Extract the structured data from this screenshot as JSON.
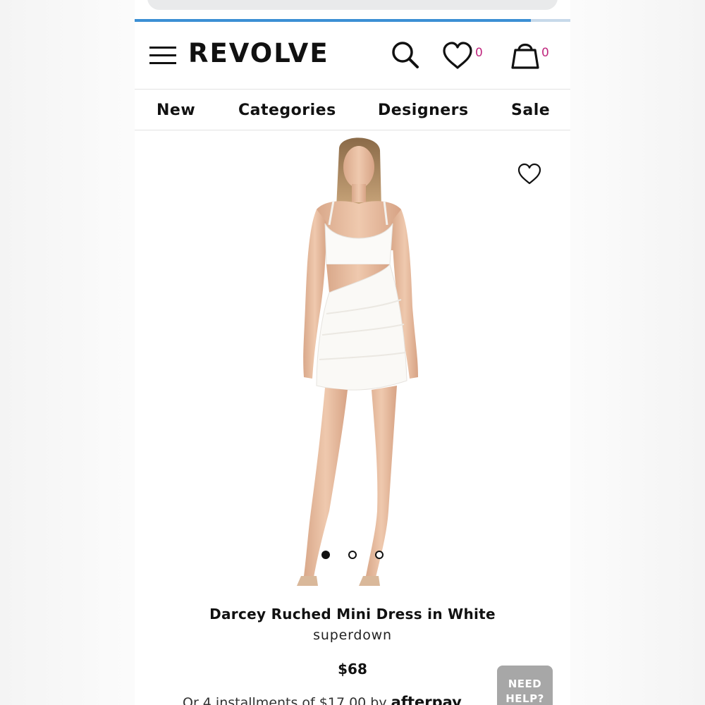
{
  "browser": {
    "page_load_progress": 0.91
  },
  "header": {
    "logo_text": "REVOLVE",
    "wishlist_count": "0",
    "bag_count": "0"
  },
  "nav": {
    "items": [
      {
        "label": "New"
      },
      {
        "label": "Categories"
      },
      {
        "label": "Designers"
      },
      {
        "label": "Sale"
      }
    ]
  },
  "product": {
    "image_description_icon": "model-photo",
    "carousel": {
      "total_dots": 3,
      "active_index": 0
    },
    "title": "Darcey Ruched Mini Dress in White",
    "brand": "superdown",
    "price": "$68",
    "installments_text": "Or 4 installments of $17.00 by",
    "installments_provider": "afterpay"
  },
  "help_button": {
    "line1": "NEED",
    "line2": "HELP?"
  },
  "colors": {
    "accent_counter": "#c0287f",
    "progress_bar": "#3b8fd4",
    "help_button_bg": "#a7a7a7"
  }
}
